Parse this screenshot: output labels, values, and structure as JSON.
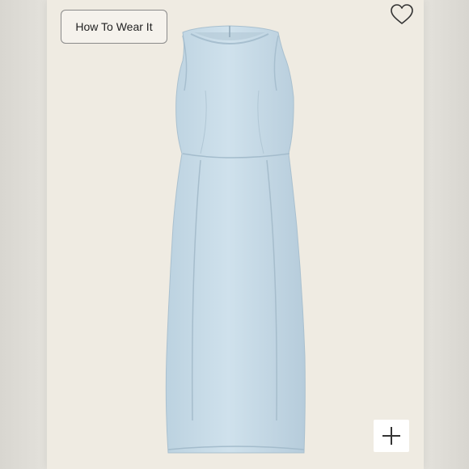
{
  "product_image": {
    "how_to_wear_label": "How To Wear It",
    "favorite_icon": "heart-outline-icon",
    "zoom_icon": "plus-icon",
    "colors": {
      "backdrop": "#efebe2",
      "dress": "#c9dce8",
      "button_border": "#8a8a8a"
    }
  }
}
